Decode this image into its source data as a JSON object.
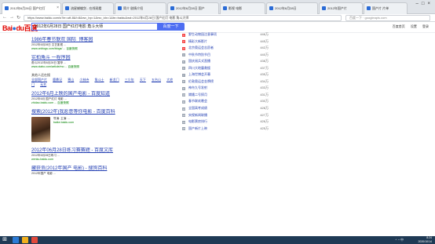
{
  "browser": {
    "tabs": [
      {
        "label": "2012年6月28日 国产红灯",
        "active": true
      },
      {
        "label": "流星蝴蝶剑 - 在线观看"
      },
      {
        "label": "简介 剧情介绍"
      },
      {
        "label": "2012年6月28日 国产"
      },
      {
        "label": "影视 电影"
      },
      {
        "label": "2012年6月28日"
      },
      {
        "label": "2012年国产片"
      },
      {
        "label": "国产片 片单"
      }
    ],
    "url": "https://www.baidu.com/s?ie=utf-8&f=8&rsv_bp=1&rsv_idx=1&tn=baidu&wd=2012年6月28日 国产红灯 电影 角斗大师",
    "search_placeholder": "百度一下 · googleapis.com"
  },
  "header": {
    "logo_text": "Bai",
    "logo_paw": "du",
    "logo_cn": "百度",
    "query": "2012年6月28日 国产红灯电影 角斗大师",
    "search_button": "百度一下",
    "links": [
      "百度首页",
      "设置",
      "登录"
    ]
  },
  "results": {
    "r1": {
      "title": "1986年春节联欢 国际_博客园",
      "abstract": "2012年6月28日 文艺影视 ...",
      "url": "www.cnblogs.com/blogs/ ... 百度快照"
    },
    "r2": {
      "title": "实拍角斗 一程序园",
      "abstract": "角斗2012年6月28日 暂停 ...",
      "url": "www.xiabo.com/article/mo ... 百度快照",
      "links": [
        "全部国产片",
        "鹿鼎记",
        "寒山",
        "少林寺",
        "角斗士",
        "新龙门",
        "三少年",
        "天下",
        "五台山",
        "大宅门",
        "无名"
      ]
    },
    "related_heading": "其他人还在搜",
    "r3": {
      "title": "2012年6月上映的国产电影 - 百度知道",
      "abstract": "2012年6月 国产红灯 电影 ...",
      "url": "zhidao.baidu.com ... 百度快照"
    },
    "r4": {
      "title": "搜索(2012年)我愿意等你电影 - 百度百科",
      "abstract": "导演:  主演:  ...",
      "url": "baike.baidu.com"
    },
    "r5": {
      "title": "2012年06月28日练习赛赛题 - 百度文库",
      "abstract": "2012年6月28日练习 ...",
      "url": "wenku.baidu.com"
    },
    "r6": {
      "title": "藏获贡(2012年国产 电影) - 搜狗百科",
      "abstract": "2012年国产 电影 ..."
    }
  },
  "ranking": [
    {
      "rank": "1",
      "title": "野生动物园注意事项",
      "count": "446万"
    },
    {
      "rank": "2",
      "title": "精彩大新影片",
      "count": "445万"
    },
    {
      "rank": "3",
      "title": "北京奥运会志愿者",
      "count": "442万"
    },
    {
      "rank": "4",
      "title": "中秋节特别节目",
      "count": "440万"
    },
    {
      "rank": "5",
      "title": "国庆阅兵式直播",
      "count": "438万"
    },
    {
      "rank": "6",
      "title": "四川大地震救援",
      "count": "437万"
    },
    {
      "rank": "7",
      "title": "上海世博会开幕",
      "count": "435万"
    },
    {
      "rank": "8",
      "title": "伦敦奥运会金牌榜",
      "count": "434万"
    },
    {
      "rank": "9",
      "title": "神舟九号发射",
      "count": "433万"
    },
    {
      "rank": "10",
      "title": "嫦娥二号探月",
      "count": "431万"
    },
    {
      "rank": "11",
      "title": "春节联欢晚会",
      "count": "430万"
    },
    {
      "rank": "12",
      "title": "全国高考成绩",
      "count": "428万"
    },
    {
      "rank": "13",
      "title": "央视新闻联播",
      "count": "427万"
    },
    {
      "rank": "14",
      "title": "电影票房排行",
      "count": "426万"
    },
    {
      "rank": "15",
      "title": "国产新片上映",
      "count": "425万"
    }
  ],
  "taskbar": {
    "time": "8:24",
    "date": "2020/10/14"
  }
}
